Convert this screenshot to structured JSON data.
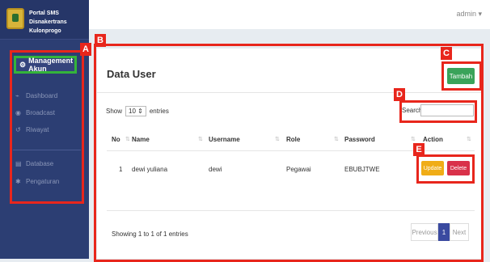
{
  "brand": {
    "title": "Portal SMS Disnakertrans Kulonprogo"
  },
  "sidebar": {
    "active_item": {
      "label": "Management Akun",
      "icon": "gear-icon"
    },
    "items": [
      {
        "label": "Dashboard",
        "icon": "chart-icon"
      },
      {
        "label": "Broadcast",
        "icon": "broadcast-icon"
      },
      {
        "label": "Riwayat",
        "icon": "history-icon"
      },
      {
        "label": "Database",
        "icon": "database-icon"
      },
      {
        "label": "Pengaturan",
        "icon": "settings-icon"
      }
    ]
  },
  "topbar": {
    "user": "admin ▾"
  },
  "annotations": {
    "a": "A",
    "b": "B",
    "c": "C",
    "d": "D",
    "e": "E"
  },
  "main": {
    "title": "Data User",
    "add_button": "Tambah",
    "show_prefix": "Show",
    "show_value": "10 ⇕",
    "show_suffix": "entries",
    "search_label": "Search:",
    "search_value": "",
    "columns": [
      "No",
      "Name",
      "Username",
      "Role",
      "Password",
      "Action"
    ],
    "rows": [
      {
        "no": "1",
        "name": "dewi yuliana",
        "username": "dewi",
        "role": "Pegawai",
        "password": "EBUBJTWE",
        "update": "Update",
        "delete": "Delete"
      }
    ],
    "showing": "Showing 1 to 1 of 1 entries",
    "pagination": {
      "previous": "Previous",
      "current": "1",
      "next": "Next"
    }
  },
  "colors": {
    "sidebar": "#2c3e73",
    "annotation": "#e8261c",
    "active_border": "#34b43a",
    "add_button": "#3aa35a",
    "update": "#f0ad17",
    "delete": "#d9314a",
    "page_active": "#3a4aa0"
  }
}
